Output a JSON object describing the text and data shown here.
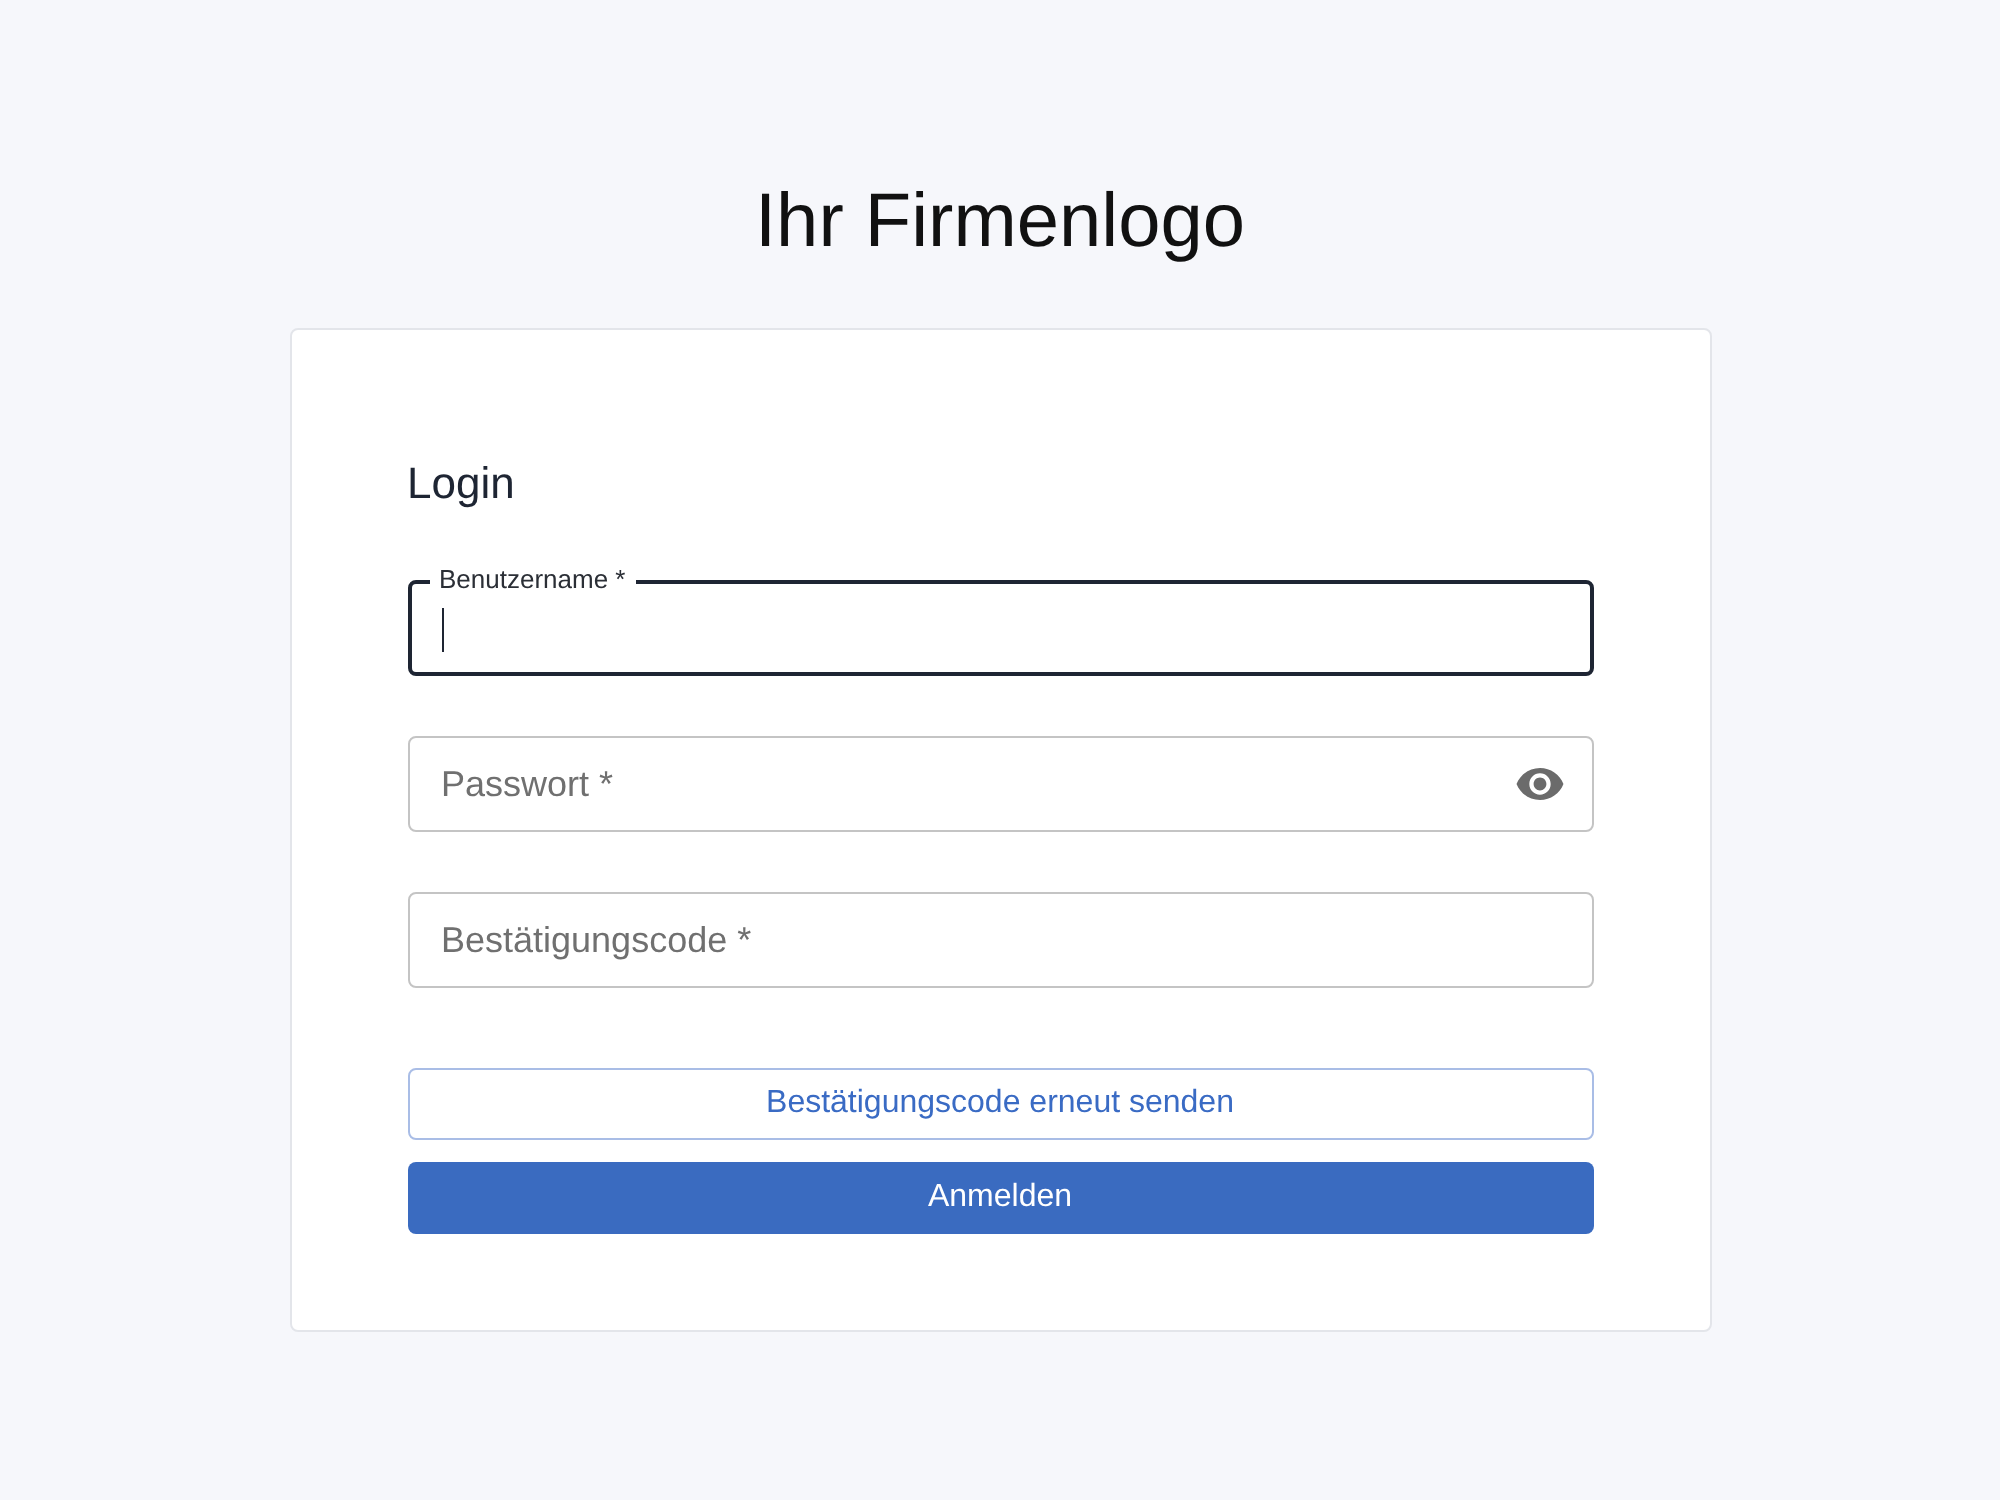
{
  "logo": {
    "text": "Ihr Firmenlogo"
  },
  "login": {
    "title": "Login",
    "fields": [
      {
        "kind": "text",
        "label": "Benutzername *",
        "focused": true
      },
      {
        "kind": "password",
        "placeholder": "Passwort *",
        "focused": false
      },
      {
        "kind": "text",
        "placeholder": "Bestätigungscode *",
        "focused": false
      }
    ],
    "buttons": [
      {
        "kind": "outline",
        "label": "Bestätigungscode erneut senden"
      },
      {
        "kind": "primary",
        "label": "Anmelden"
      }
    ]
  }
}
